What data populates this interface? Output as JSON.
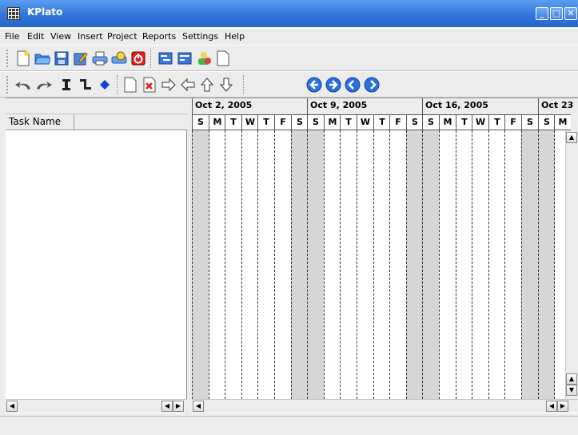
{
  "window": {
    "title": "KPlato",
    "controls": [
      "minimize",
      "maximize",
      "close"
    ]
  },
  "menubar": {
    "items": [
      "File",
      "Edit",
      "View",
      "Insert",
      "Project",
      "Reports",
      "Settings",
      "Help"
    ]
  },
  "toolbar1": {
    "icons": [
      "new-document-icon",
      "open-folder-icon",
      "save-icon",
      "edit-icon",
      "print-icon",
      "print-preview-icon",
      "quit-icon",
      "gantt-view-icon",
      "resource-view-icon",
      "accounts-icon",
      "report-icon"
    ]
  },
  "toolbar2": {
    "icons": [
      "undo-icon",
      "redo-icon",
      "add-task-icon",
      "add-subtask-icon",
      "add-milestone-icon",
      "new-view-icon",
      "delete-task-icon",
      "indent-icon",
      "unindent-icon",
      "move-up-icon",
      "move-down-icon",
      "go-back-icon",
      "go-forward-icon",
      "go-previous-icon",
      "go-next-icon"
    ]
  },
  "task_list": {
    "column_header": "Task Name"
  },
  "gantt": {
    "weeks": [
      "Oct 2, 2005",
      "Oct 9, 2005",
      "Oct 16, 2005",
      "Oct 23"
    ],
    "days": [
      "S",
      "M",
      "T",
      "W",
      "T",
      "F",
      "S",
      "S",
      "M",
      "T",
      "W",
      "T",
      "F",
      "S",
      "S",
      "M",
      "T",
      "W",
      "T",
      "F",
      "S",
      "S",
      "M"
    ],
    "weekend_color": "#d6d6d6"
  },
  "colors": {
    "titlebar": "#2f72d8",
    "accent_blue": "#2d6fe0"
  }
}
